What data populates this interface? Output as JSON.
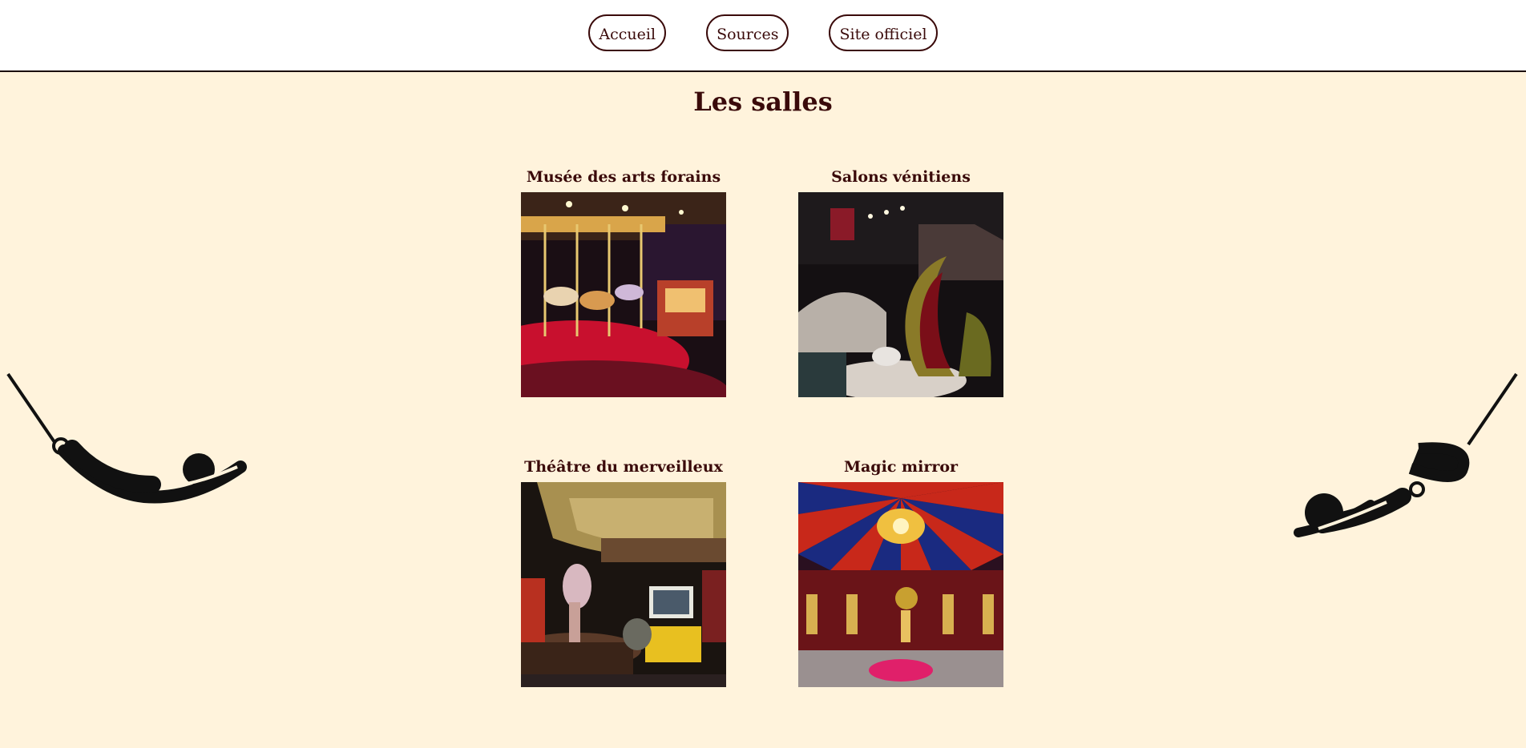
{
  "nav": {
    "items": [
      {
        "label": "Accueil"
      },
      {
        "label": "Sources"
      },
      {
        "label": "Site officiel"
      }
    ]
  },
  "page": {
    "title": "Les salles"
  },
  "rooms": [
    {
      "title": "Musée des arts forains",
      "image": "carousel-photo"
    },
    {
      "title": "Salons vénitiens",
      "image": "venetian-salon-photo"
    },
    {
      "title": "Théâtre du merveilleux",
      "image": "theatre-photo"
    },
    {
      "title": "Magic mirror",
      "image": "magic-mirror-tent-photo"
    }
  ],
  "colors": {
    "background": "#fff3dc",
    "text": "#3a0a0a",
    "header": "#ffffff"
  }
}
